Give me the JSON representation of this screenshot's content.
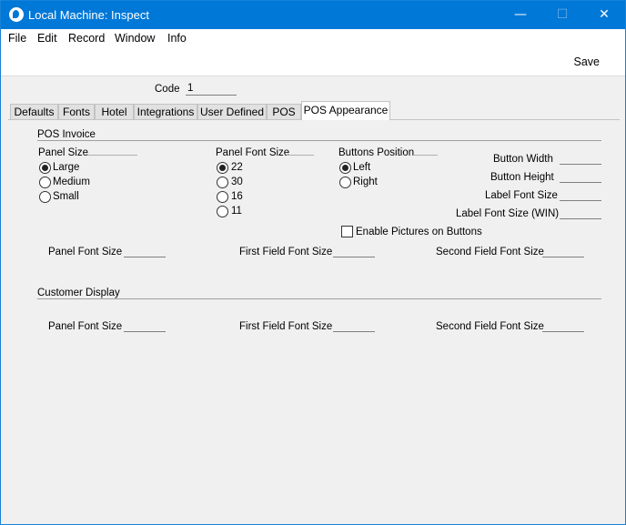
{
  "window": {
    "title": "Local Machine: Inspect",
    "minimize_glyph": "—",
    "maximize_glyph": "☐",
    "close_glyph": "✕"
  },
  "menu": {
    "items": [
      "File",
      "Edit",
      "Record",
      "Window",
      "Info"
    ]
  },
  "toolbar": {
    "save_label": "Save"
  },
  "header": {
    "code_label": "Code",
    "code_value": "1"
  },
  "tabs": [
    "Defaults",
    "Fonts",
    "Hotel",
    "Integrations",
    "User Defined",
    "POS",
    "POS Appearance"
  ],
  "active_tab": "POS Appearance",
  "pos_invoice": {
    "heading": "POS Invoice",
    "panel_size": {
      "label": "Panel Size",
      "options": [
        "Large",
        "Medium",
        "Small"
      ],
      "selected": "Large"
    },
    "panel_font_size": {
      "label": "Panel Font Size",
      "options": [
        "22",
        "30",
        "16",
        "11"
      ],
      "selected": "22"
    },
    "buttons_position": {
      "label": "Buttons Position",
      "options": [
        "Left",
        "Right"
      ],
      "selected": "Left"
    },
    "button_width_label": "Button Width",
    "button_height_label": "Button Height",
    "label_font_size_label": "Label Font Size",
    "label_font_size_win_label": "Label Font Size (WIN)",
    "enable_pictures_label": "Enable Pictures on Buttons",
    "enable_pictures_checked": false,
    "panel_font_size_field_label": "Panel Font Size",
    "first_field_font_size_label": "First Field Font Size",
    "second_field_font_size_label": "Second Field Font Size"
  },
  "customer_display": {
    "heading": "Customer Display",
    "panel_font_size_label": "Panel Font Size",
    "first_field_font_size_label": "First Field Font Size",
    "second_field_font_size_label": "Second Field Font Size"
  },
  "colors": {
    "titlebar": "#0078d7",
    "window_bg": "#f0f0f0",
    "toolbar_bg": "#ffffff"
  }
}
